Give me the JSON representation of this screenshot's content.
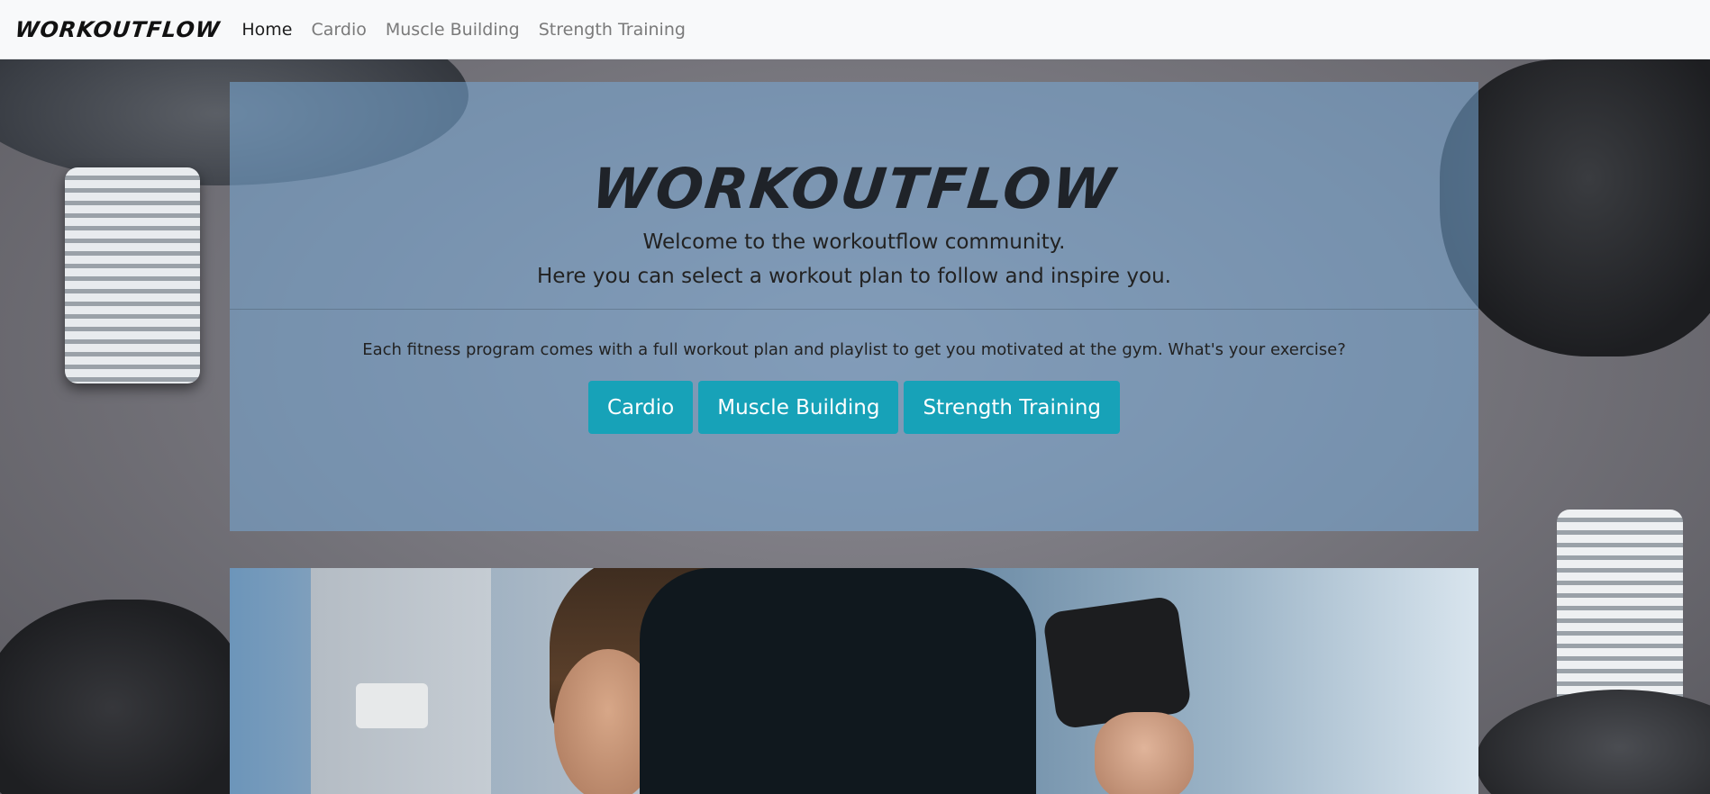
{
  "navbar": {
    "brand": "WORKOUTFLOW",
    "links": [
      {
        "label": "Home",
        "active": true
      },
      {
        "label": "Cardio",
        "active": false
      },
      {
        "label": "Muscle Building",
        "active": false
      },
      {
        "label": "Strength Training",
        "active": false
      }
    ]
  },
  "hero": {
    "title": "WORKOUTFLOW",
    "lead_line1": "Welcome to the workoutflow community.",
    "lead_line2": "Here you can select a workout plan to follow and inspire you.",
    "text": "Each fitness program comes with a full workout plan and playlist to get you motivated at the gym. What's your exercise?",
    "buttons": [
      "Cardio",
      "Muscle Building",
      "Strength Training"
    ]
  },
  "colors": {
    "button_bg": "#17a2b8",
    "navbar_bg": "#f8f9fa",
    "hero_overlay": "#78aad7"
  }
}
